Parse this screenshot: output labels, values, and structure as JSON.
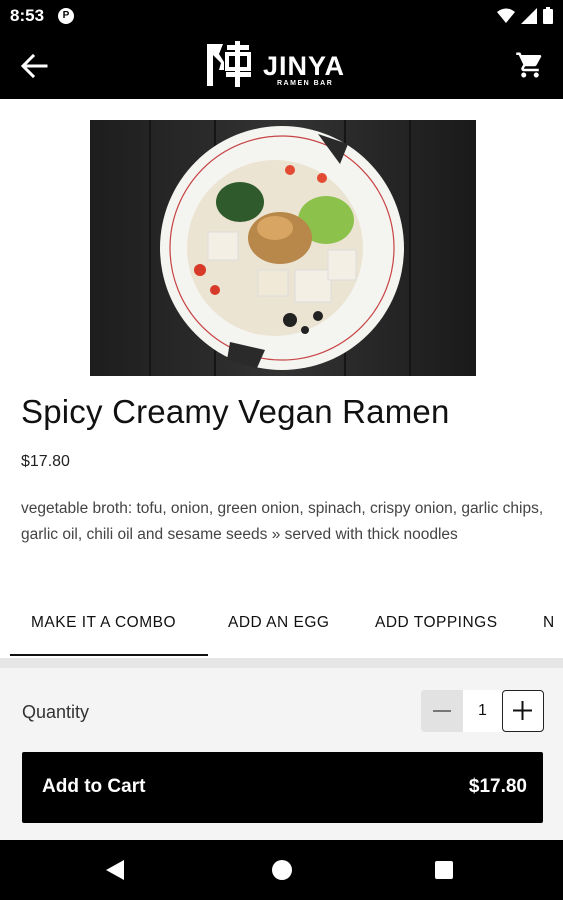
{
  "status": {
    "time": "8:53",
    "pill_letter": "P"
  },
  "brand": {
    "kanji": "陣",
    "name": "JINYA",
    "tagline": "RAMEN BAR"
  },
  "product": {
    "title": "Spicy Creamy Vegan Ramen",
    "price": "$17.80",
    "description": "vegetable broth: tofu, onion, green onion, spinach, crispy onion, garlic chips, garlic oil, chili oil and sesame seeds » served with thick noodles"
  },
  "tabs": [
    {
      "label": "MAKE IT A COMBO",
      "selected": true
    },
    {
      "label": "ADD AN EGG",
      "selected": false
    },
    {
      "label": "ADD TOPPINGS",
      "selected": false
    },
    {
      "label": "N",
      "selected": false
    }
  ],
  "quantity": {
    "label": "Quantity",
    "value": "1"
  },
  "cart_button": {
    "label": "Add to Cart",
    "price": "$17.80"
  },
  "colors": {
    "bar": "#000000",
    "panel": "#f4f4f4",
    "accent": "#111111"
  },
  "icons": [
    "back-arrow-icon",
    "cart-icon",
    "wifi-icon",
    "signal-icon",
    "battery-icon",
    "minus-icon",
    "plus-icon",
    "nav-back-icon",
    "nav-home-icon",
    "nav-recents-icon"
  ]
}
